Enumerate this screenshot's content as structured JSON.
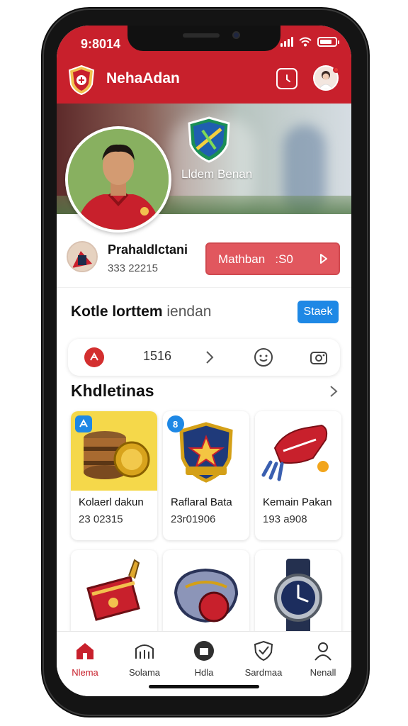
{
  "status_bar": {
    "time": "9:8014"
  },
  "header": {
    "app_title": "NehaAdan",
    "logo_icon": "club-shield-icon",
    "action_icon": "clock-icon",
    "avatar_icon": "user-avatar"
  },
  "hero": {
    "team_name": "Lldem Benan",
    "badge_icon": "team-badge-icon"
  },
  "profile": {
    "name": "Prahaldlctani",
    "sub": "333 22215",
    "cta_label": "Mathban",
    "cta_value": "S0",
    "cta_icon": "chevron-right-icon"
  },
  "section": {
    "title_bold": "Kotle lorttem",
    "title_light": "iendan",
    "button_label": "Staek"
  },
  "icon_bar": {
    "value": "1516",
    "icons": [
      "balloon-icon",
      "chevron-right-icon",
      "smiley-icon",
      "camera-icon"
    ]
  },
  "collection": {
    "title": "Khdletinas",
    "items": [
      {
        "name": "Kolaerl dakun",
        "price": "23 02315",
        "icon": "treasure-barrel-icon"
      },
      {
        "name": "Raflaral Bata",
        "price": "23r01906",
        "icon": "star-badge-icon"
      },
      {
        "name": "Kemain Pakan",
        "price": "193 a908",
        "icon": "red-boot-icon"
      }
    ],
    "more": [
      "red-bag-icon",
      "glove-ball-icon",
      "wristwatch-icon"
    ]
  },
  "bottom_nav": [
    {
      "label": "Nlema",
      "icon": "home-icon",
      "active": true
    },
    {
      "label": "Solama",
      "icon": "stadium-icon",
      "active": false
    },
    {
      "label": "Hdla",
      "icon": "shop-icon",
      "active": false
    },
    {
      "label": "Sardmaa",
      "icon": "shield-check-icon",
      "active": false
    },
    {
      "label": "Nenall",
      "icon": "profile-icon",
      "active": false
    }
  ],
  "colors": {
    "primary": "#c8202c",
    "accent_blue": "#1e88e5",
    "cta": "#e1575e"
  }
}
